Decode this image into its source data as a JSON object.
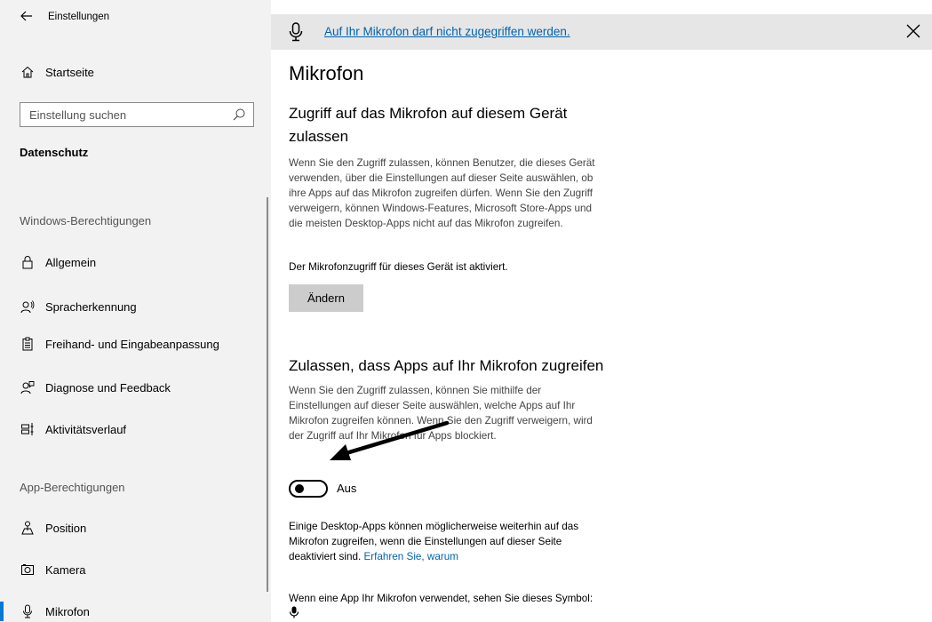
{
  "window": {
    "title": "Einstellungen"
  },
  "sidebar": {
    "home_label": "Startseite",
    "search_placeholder": "Einstellung suchen",
    "section_title": "Datenschutz",
    "group_windows": "Windows-Berechtigungen",
    "group_apps": "App-Berechtigungen",
    "items": [
      {
        "label": "Allgemein",
        "icon": "lock-icon"
      },
      {
        "label": "Spracherkennung",
        "icon": "speech-icon"
      },
      {
        "label": "Freihand- und Eingabeanpassung",
        "icon": "clipboard-icon"
      },
      {
        "label": "Diagnose und Feedback",
        "icon": "feedback-icon"
      },
      {
        "label": "Aktivitätsverlauf",
        "icon": "timeline-icon"
      },
      {
        "label": "Position",
        "icon": "location-icon"
      },
      {
        "label": "Kamera",
        "icon": "camera-icon"
      },
      {
        "label": "Mikrofon",
        "icon": "microphone-icon",
        "selected": true
      }
    ]
  },
  "banner": {
    "text": "Auf Ihr Mikrofon darf nicht zugegriffen werden."
  },
  "main": {
    "title": "Mikrofon",
    "section1": {
      "heading_line1": "Zugriff auf das Mikrofon auf diesem Gerät",
      "heading_line2": "zulassen",
      "description_lines": [
        "Wenn Sie den Zugriff zulassen, können Benutzer, die dieses Gerät",
        "verwenden, über die Einstellungen auf dieser Seite auswählen, ob",
        "ihre Apps auf das Mikrofon zugreifen dürfen. Wenn Sie den Zugriff",
        "verweigern, können Windows-Features, Microsoft Store-Apps und",
        "die meisten Desktop-Apps nicht auf das Mikrofon zugreifen."
      ],
      "status": "Der Mikrofonzugriff für dieses Gerät ist aktiviert.",
      "change_button": "Ändern"
    },
    "section2": {
      "heading": "Zulassen, dass Apps auf Ihr Mikrofon zugreifen",
      "description_lines": [
        "Wenn Sie den Zugriff zulassen, können Sie mithilfe der",
        "Einstellungen auf dieser Seite auswählen, welche Apps auf Ihr",
        "Mikrofon zugreifen können. Wenn Sie den Zugriff verweigern, wird",
        "der Zugriff auf Ihr Mikrofon für Apps blockiert."
      ],
      "toggle_state": "Aus",
      "desktop_note_lines": [
        "Einige Desktop-Apps können möglicherweise weiterhin auf das",
        "Mikrofon zugreifen, wenn die Einstellungen auf dieser Seite",
        "deaktiviert sind."
      ],
      "learn_more_link": "Erfahren Sie, warum",
      "symbol_note": "Wenn eine App Ihr Mikrofon verwendet, sehen Sie dieses Symbol:"
    }
  },
  "colors": {
    "accent": "#0078d7",
    "link": "#0063b1",
    "sidebar_bg": "#f2f2f2",
    "banner_bg": "#e6e6e6"
  }
}
